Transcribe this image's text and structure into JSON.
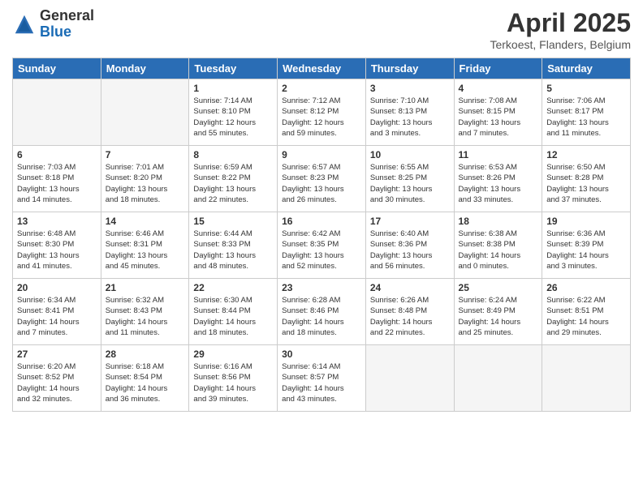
{
  "logo": {
    "general": "General",
    "blue": "Blue"
  },
  "title": "April 2025",
  "location": "Terkoest, Flanders, Belgium",
  "weekdays": [
    "Sunday",
    "Monday",
    "Tuesday",
    "Wednesday",
    "Thursday",
    "Friday",
    "Saturday"
  ],
  "weeks": [
    [
      {
        "day": "",
        "info": ""
      },
      {
        "day": "",
        "info": ""
      },
      {
        "day": "1",
        "info": "Sunrise: 7:14 AM\nSunset: 8:10 PM\nDaylight: 12 hours\nand 55 minutes."
      },
      {
        "day": "2",
        "info": "Sunrise: 7:12 AM\nSunset: 8:12 PM\nDaylight: 12 hours\nand 59 minutes."
      },
      {
        "day": "3",
        "info": "Sunrise: 7:10 AM\nSunset: 8:13 PM\nDaylight: 13 hours\nand 3 minutes."
      },
      {
        "day": "4",
        "info": "Sunrise: 7:08 AM\nSunset: 8:15 PM\nDaylight: 13 hours\nand 7 minutes."
      },
      {
        "day": "5",
        "info": "Sunrise: 7:06 AM\nSunset: 8:17 PM\nDaylight: 13 hours\nand 11 minutes."
      }
    ],
    [
      {
        "day": "6",
        "info": "Sunrise: 7:03 AM\nSunset: 8:18 PM\nDaylight: 13 hours\nand 14 minutes."
      },
      {
        "day": "7",
        "info": "Sunrise: 7:01 AM\nSunset: 8:20 PM\nDaylight: 13 hours\nand 18 minutes."
      },
      {
        "day": "8",
        "info": "Sunrise: 6:59 AM\nSunset: 8:22 PM\nDaylight: 13 hours\nand 22 minutes."
      },
      {
        "day": "9",
        "info": "Sunrise: 6:57 AM\nSunset: 8:23 PM\nDaylight: 13 hours\nand 26 minutes."
      },
      {
        "day": "10",
        "info": "Sunrise: 6:55 AM\nSunset: 8:25 PM\nDaylight: 13 hours\nand 30 minutes."
      },
      {
        "day": "11",
        "info": "Sunrise: 6:53 AM\nSunset: 8:26 PM\nDaylight: 13 hours\nand 33 minutes."
      },
      {
        "day": "12",
        "info": "Sunrise: 6:50 AM\nSunset: 8:28 PM\nDaylight: 13 hours\nand 37 minutes."
      }
    ],
    [
      {
        "day": "13",
        "info": "Sunrise: 6:48 AM\nSunset: 8:30 PM\nDaylight: 13 hours\nand 41 minutes."
      },
      {
        "day": "14",
        "info": "Sunrise: 6:46 AM\nSunset: 8:31 PM\nDaylight: 13 hours\nand 45 minutes."
      },
      {
        "day": "15",
        "info": "Sunrise: 6:44 AM\nSunset: 8:33 PM\nDaylight: 13 hours\nand 48 minutes."
      },
      {
        "day": "16",
        "info": "Sunrise: 6:42 AM\nSunset: 8:35 PM\nDaylight: 13 hours\nand 52 minutes."
      },
      {
        "day": "17",
        "info": "Sunrise: 6:40 AM\nSunset: 8:36 PM\nDaylight: 13 hours\nand 56 minutes."
      },
      {
        "day": "18",
        "info": "Sunrise: 6:38 AM\nSunset: 8:38 PM\nDaylight: 14 hours\nand 0 minutes."
      },
      {
        "day": "19",
        "info": "Sunrise: 6:36 AM\nSunset: 8:39 PM\nDaylight: 14 hours\nand 3 minutes."
      }
    ],
    [
      {
        "day": "20",
        "info": "Sunrise: 6:34 AM\nSunset: 8:41 PM\nDaylight: 14 hours\nand 7 minutes."
      },
      {
        "day": "21",
        "info": "Sunrise: 6:32 AM\nSunset: 8:43 PM\nDaylight: 14 hours\nand 11 minutes."
      },
      {
        "day": "22",
        "info": "Sunrise: 6:30 AM\nSunset: 8:44 PM\nDaylight: 14 hours\nand 18 minutes."
      },
      {
        "day": "23",
        "info": "Sunrise: 6:28 AM\nSunset: 8:46 PM\nDaylight: 14 hours\nand 18 minutes."
      },
      {
        "day": "24",
        "info": "Sunrise: 6:26 AM\nSunset: 8:48 PM\nDaylight: 14 hours\nand 22 minutes."
      },
      {
        "day": "25",
        "info": "Sunrise: 6:24 AM\nSunset: 8:49 PM\nDaylight: 14 hours\nand 25 minutes."
      },
      {
        "day": "26",
        "info": "Sunrise: 6:22 AM\nSunset: 8:51 PM\nDaylight: 14 hours\nand 29 minutes."
      }
    ],
    [
      {
        "day": "27",
        "info": "Sunrise: 6:20 AM\nSunset: 8:52 PM\nDaylight: 14 hours\nand 32 minutes."
      },
      {
        "day": "28",
        "info": "Sunrise: 6:18 AM\nSunset: 8:54 PM\nDaylight: 14 hours\nand 36 minutes."
      },
      {
        "day": "29",
        "info": "Sunrise: 6:16 AM\nSunset: 8:56 PM\nDaylight: 14 hours\nand 39 minutes."
      },
      {
        "day": "30",
        "info": "Sunrise: 6:14 AM\nSunset: 8:57 PM\nDaylight: 14 hours\nand 43 minutes."
      },
      {
        "day": "",
        "info": ""
      },
      {
        "day": "",
        "info": ""
      },
      {
        "day": "",
        "info": ""
      }
    ]
  ]
}
